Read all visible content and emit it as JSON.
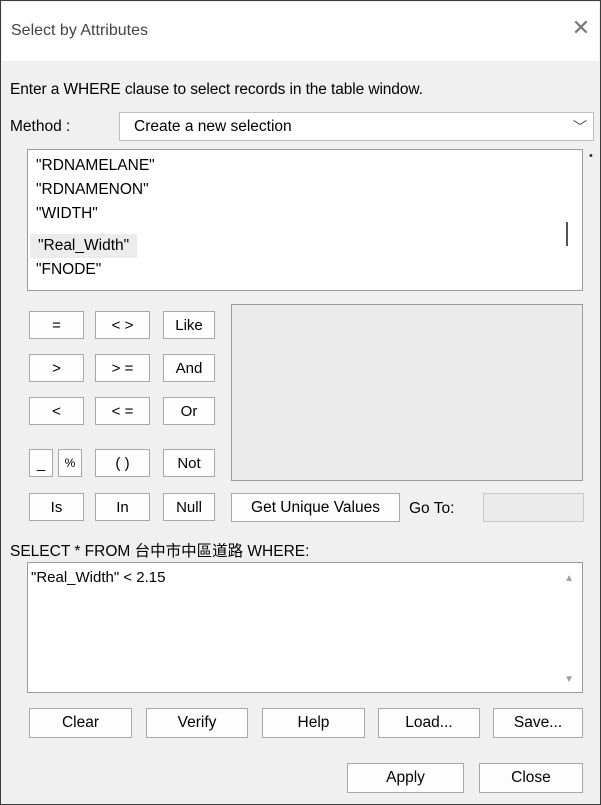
{
  "window": {
    "title": "Select by Attributes",
    "close_glyph": "✕"
  },
  "instruction": "Enter a WHERE clause to select records in the table window.",
  "method": {
    "label": "Method :",
    "value": "Create a new selection",
    "chevron": "﹀"
  },
  "field_list": {
    "items": [
      "\"RDNAMELANE\"",
      "\"RDNAMENON\"",
      "\"WIDTH\"",
      "\"Real_Width\"",
      "\"FNODE\""
    ],
    "selected_index": 3
  },
  "operators": {
    "eq": "=",
    "ne": "< >",
    "like": "Like",
    "gt": ">",
    "ge": "> =",
    "and": "And",
    "lt": "<",
    "le": "< =",
    "or": "Or",
    "underscore": "_",
    "percent": "%",
    "parens": "( )",
    "not": "Not",
    "is": "Is",
    "in": "In",
    "null": "Null"
  },
  "get_unique_values": "Get Unique Values",
  "goto": {
    "label": "Go To:",
    "value": ""
  },
  "select_clause": "SELECT * FROM 台中市中區道路 WHERE:",
  "where_clause": "\"Real_Width\" < 2.15",
  "scroll_glyphs": {
    "up": "▲",
    "down": "▼",
    "dot": "•"
  },
  "actions": {
    "clear": "Clear",
    "verify": "Verify",
    "help": "Help",
    "load": "Load...",
    "save": "Save..."
  },
  "footer": {
    "apply": "Apply",
    "close": "Close"
  }
}
